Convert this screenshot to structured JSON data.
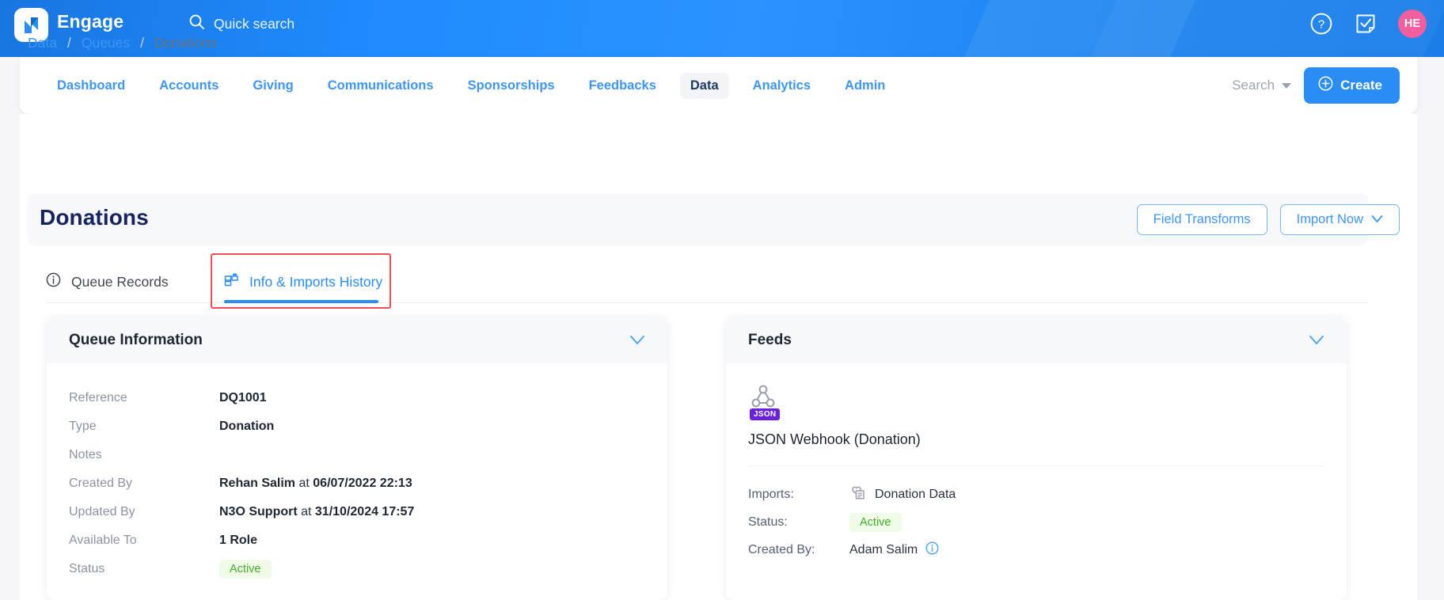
{
  "header": {
    "brand": "Engage",
    "logo_icon": "engage-logo-icon",
    "search_placeholder": "Quick search",
    "search_icon": "search-icon",
    "help_icon": "help-circle-icon",
    "tasks_icon": "task-note-icon",
    "avatar_initials": "HE",
    "avatar_color": "#f25f9c",
    "brand_color": "#2a8cf5"
  },
  "nav": {
    "items": [
      {
        "label": "Dashboard",
        "active": false
      },
      {
        "label": "Accounts",
        "active": false
      },
      {
        "label": "Giving",
        "active": false
      },
      {
        "label": "Communications",
        "active": false
      },
      {
        "label": "Sponsorships",
        "active": false
      },
      {
        "label": "Feedbacks",
        "active": false
      },
      {
        "label": "Data",
        "active": true
      },
      {
        "label": "Analytics",
        "active": false
      },
      {
        "label": "Admin",
        "active": false
      }
    ],
    "search_label": "Search",
    "search_caret_icon": "chevron-down-icon",
    "create_label": "Create",
    "create_icon": "plus-circle-icon"
  },
  "breadcrumb": {
    "items": [
      "Data",
      "Queues",
      "Donations"
    ],
    "separator": "/"
  },
  "page": {
    "title": "Donations",
    "actions": [
      {
        "label": "Field Transforms",
        "has_caret": false
      },
      {
        "label": "Import Now",
        "has_caret": true,
        "caret_icon": "chevron-down-icon"
      }
    ]
  },
  "tabs": [
    {
      "label": "Queue Records",
      "icon": "info-circle-icon",
      "active": false
    },
    {
      "label": "Info & Imports History",
      "icon": "layout-grid-icon",
      "active": true
    }
  ],
  "highlight_color": "#f04f4f",
  "queue_information": {
    "title": "Queue Information",
    "collapse_icon": "chevron-down-icon",
    "rows": [
      {
        "key": "Reference",
        "value": "DQ1001",
        "type": "text"
      },
      {
        "key": "Type",
        "value": "Donation",
        "type": "text"
      },
      {
        "key": "Notes",
        "value": "",
        "type": "text"
      },
      {
        "key": "Created By",
        "value": "Rehan Salim",
        "connector": " at ",
        "value2": "06/07/2022 22:13",
        "type": "actor-time"
      },
      {
        "key": "Updated By",
        "value": "N3O Support",
        "connector": " at ",
        "value2": "31/10/2024 17:57",
        "type": "actor-time"
      },
      {
        "key": "Available To",
        "value": "1 Role",
        "type": "text"
      },
      {
        "key": "Status",
        "value": "Active",
        "type": "pill"
      }
    ]
  },
  "feeds": {
    "title": "Feeds",
    "collapse_icon": "chevron-down-icon",
    "feed": {
      "icon": "webhook-icon",
      "badge": "JSON",
      "badge_color": "#6b21d9",
      "name": "JSON Webhook (Donation)"
    },
    "details": [
      {
        "key": "Imports:",
        "value": "Donation Data",
        "icon": "donation-data-icon",
        "type": "icon-text"
      },
      {
        "key": "Status:",
        "value": "Active",
        "type": "pill"
      },
      {
        "key": "Created By:",
        "value": "Adam Salim",
        "icon": "info-circle-icon",
        "type": "text-info"
      }
    ]
  }
}
